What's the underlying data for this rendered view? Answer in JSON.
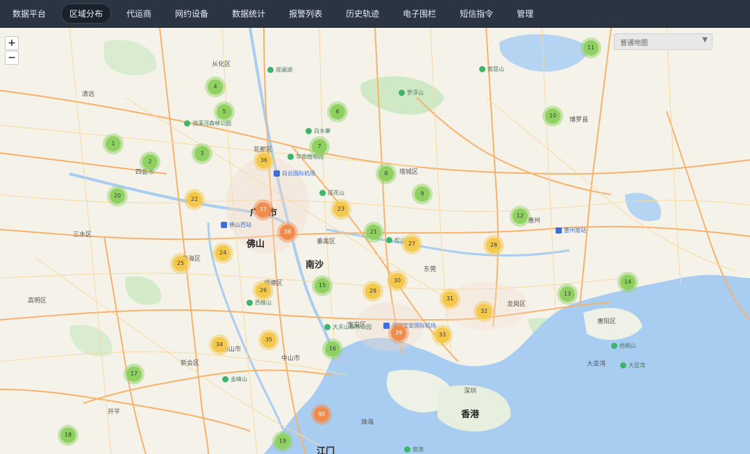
{
  "nav": {
    "items": [
      {
        "label": "数据平台",
        "active": false
      },
      {
        "label": "区域分布",
        "active": true
      },
      {
        "label": "代运商",
        "active": false
      },
      {
        "label": "网约设备",
        "active": false
      },
      {
        "label": "数据统计",
        "active": false
      },
      {
        "label": "报警列表",
        "active": false
      },
      {
        "label": "历史轨迹",
        "active": false
      },
      {
        "label": "电子围栏",
        "active": false
      },
      {
        "label": "短信指令",
        "active": false
      },
      {
        "label": "管理",
        "active": false
      }
    ]
  },
  "map": {
    "zoom_in_label": "+",
    "zoom_out_label": "−",
    "map_type": {
      "label": "普通地图",
      "caret": "▼"
    },
    "places": [
      {
        "label": "广州市",
        "big": true
      },
      {
        "label": "佛山",
        "big": true
      },
      {
        "label": "南沙",
        "big": true
      },
      {
        "label": "东莞",
        "big": false
      },
      {
        "label": "中山市",
        "big": false
      },
      {
        "label": "深圳",
        "big": false
      },
      {
        "label": "香港",
        "big": true
      },
      {
        "label": "江门",
        "big": true
      },
      {
        "label": "惠州",
        "big": false
      },
      {
        "label": "从化区",
        "big": false
      },
      {
        "label": "花都区",
        "big": false
      },
      {
        "label": "增城区",
        "big": false
      },
      {
        "label": "番禺区",
        "big": false
      },
      {
        "label": "顺德区",
        "big": false
      },
      {
        "label": "南海区",
        "big": false
      },
      {
        "label": "三水区",
        "big": false
      },
      {
        "label": "高明区",
        "big": false
      },
      {
        "label": "新会区",
        "big": false
      },
      {
        "label": "博罗县",
        "big": false
      },
      {
        "label": "惠阳区",
        "big": false
      },
      {
        "label": "大亚湾",
        "big": false
      },
      {
        "label": "宝安区",
        "big": false
      },
      {
        "label": "龙岗区",
        "big": false
      },
      {
        "label": "清远",
        "big": false
      },
      {
        "label": "四会市",
        "big": false
      },
      {
        "label": "鹤山市",
        "big": false
      },
      {
        "label": "开平",
        "big": false
      },
      {
        "label": "珠海",
        "big": false
      }
    ],
    "pois": [
      {
        "label": "白云国际机场",
        "kind": "blue"
      },
      {
        "label": "华南植物园",
        "kind": "green"
      },
      {
        "label": "流溪河森林公园",
        "kind": "green"
      },
      {
        "label": "佛山西站",
        "kind": "blue"
      },
      {
        "label": "深圳宝安国际机场",
        "kind": "blue"
      },
      {
        "label": "南昆山",
        "kind": "green"
      },
      {
        "label": "惠州南站",
        "kind": "blue"
      },
      {
        "label": "罗浮山",
        "kind": "green"
      },
      {
        "label": "大夫山森林公园",
        "kind": "green"
      },
      {
        "label": "白水寨",
        "kind": "green"
      },
      {
        "label": "西樵山",
        "kind": "green"
      },
      {
        "label": "莲花山",
        "kind": "green"
      },
      {
        "label": "松山湖",
        "kind": "green"
      },
      {
        "label": "观澜湖",
        "kind": "green"
      },
      {
        "label": "梧桐山",
        "kind": "green"
      },
      {
        "label": "南澳",
        "kind": "green"
      },
      {
        "label": "圭峰山",
        "kind": "green"
      },
      {
        "label": "大亚湾",
        "kind": "green"
      }
    ],
    "clusters": [
      {
        "label": "1",
        "level": "green"
      },
      {
        "label": "2",
        "level": "green"
      },
      {
        "label": "3",
        "level": "green"
      },
      {
        "label": "4",
        "level": "green"
      },
      {
        "label": "5",
        "level": "green"
      },
      {
        "label": "6",
        "level": "green"
      },
      {
        "label": "7",
        "level": "green"
      },
      {
        "label": "8",
        "level": "green"
      },
      {
        "label": "9",
        "level": "green"
      },
      {
        "label": "10",
        "level": "green"
      },
      {
        "label": "11",
        "level": "green"
      },
      {
        "label": "12",
        "level": "green"
      },
      {
        "label": "13",
        "level": "green"
      },
      {
        "label": "14",
        "level": "green"
      },
      {
        "label": "15",
        "level": "green"
      },
      {
        "label": "16",
        "level": "green"
      },
      {
        "label": "17",
        "level": "green"
      },
      {
        "label": "18",
        "level": "green"
      },
      {
        "label": "19",
        "level": "green"
      },
      {
        "label": "20",
        "level": "green"
      },
      {
        "label": "21",
        "level": "green"
      },
      {
        "label": "22",
        "level": "yellow"
      },
      {
        "label": "23",
        "level": "yellow"
      },
      {
        "label": "24",
        "level": "yellow"
      },
      {
        "label": "25",
        "level": "yellow"
      },
      {
        "label": "26",
        "level": "yellow"
      },
      {
        "label": "27",
        "level": "yellow"
      },
      {
        "label": "28",
        "level": "yellow"
      },
      {
        "label": "29",
        "level": "yellow"
      },
      {
        "label": "30",
        "level": "yellow"
      },
      {
        "label": "31",
        "level": "yellow"
      },
      {
        "label": "32",
        "level": "yellow"
      },
      {
        "label": "33",
        "level": "yellow"
      },
      {
        "label": "34",
        "level": "yellow"
      },
      {
        "label": "35",
        "level": "yellow"
      },
      {
        "label": "36",
        "level": "yellow"
      },
      {
        "label": "37",
        "level": "orange"
      },
      {
        "label": "38",
        "level": "orange"
      },
      {
        "label": "39",
        "level": "orange"
      },
      {
        "label": "40",
        "level": "orange"
      }
    ]
  }
}
